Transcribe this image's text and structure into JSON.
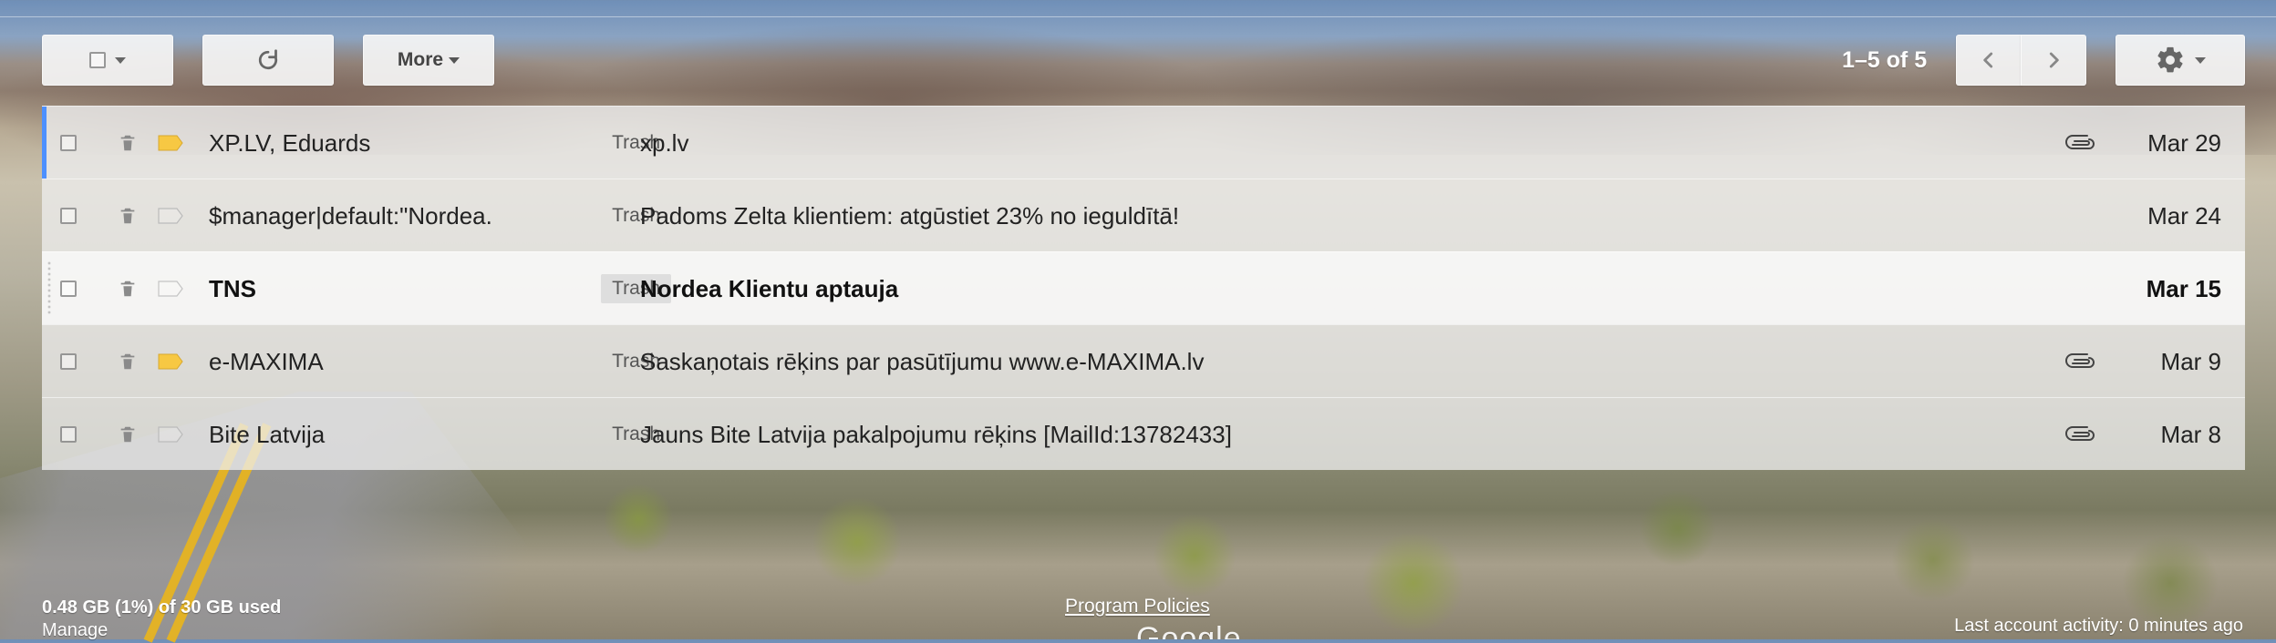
{
  "toolbar": {
    "more_label": "More",
    "pager_text": "1–5 of 5"
  },
  "icons": {
    "select": "checkbox-icon",
    "refresh": "refresh-icon",
    "prev": "chevron-left-icon",
    "next": "chevron-right-icon",
    "settings": "gear-icon",
    "trash": "trash-icon",
    "label": "label-icon",
    "attachment": "paperclip-icon"
  },
  "colors": {
    "label_yellow": "#f7c843",
    "selected_bar": "#4d90fe"
  },
  "messages": [
    {
      "sender": "XP.LV, Eduards",
      "folder": "Trash",
      "subject": "xp.lv",
      "date": "Mar 29",
      "label_color": "yellow",
      "has_attachment": true,
      "unread": false
    },
    {
      "sender": "$manager|default:\"Nordea.",
      "folder": "Trash",
      "subject": "Padoms Zelta klientiem: atgūstiet 23% no ieguldītā!",
      "date": "Mar 24",
      "label_color": "none",
      "has_attachment": false,
      "unread": false
    },
    {
      "sender": "TNS",
      "folder": "Trash",
      "subject": "Nordea Klientu aptauja",
      "date": "Mar 15",
      "label_color": "none",
      "has_attachment": false,
      "unread": true
    },
    {
      "sender": "e-MAXIMA",
      "folder": "Trash",
      "subject": "Saskaņotais rēķins par pasūtījumu www.e-MAXIMA.lv",
      "date": "Mar 9",
      "label_color": "yellow",
      "has_attachment": true,
      "unread": false
    },
    {
      "sender": "Bite Latvija",
      "folder": "Trash",
      "subject": "Jauns Bite Latvija pakalpojumu rēķins [MailId:13782433]",
      "date": "Mar 8",
      "label_color": "none",
      "has_attachment": true,
      "unread": false
    }
  ],
  "footer": {
    "storage_text": "0.48 GB (1%) of 30 GB used",
    "manage_label": "Manage",
    "program_policies_label": "Program Policies",
    "activity_text": "Last account activity: 0 minutes ago",
    "google_text": "Google"
  }
}
